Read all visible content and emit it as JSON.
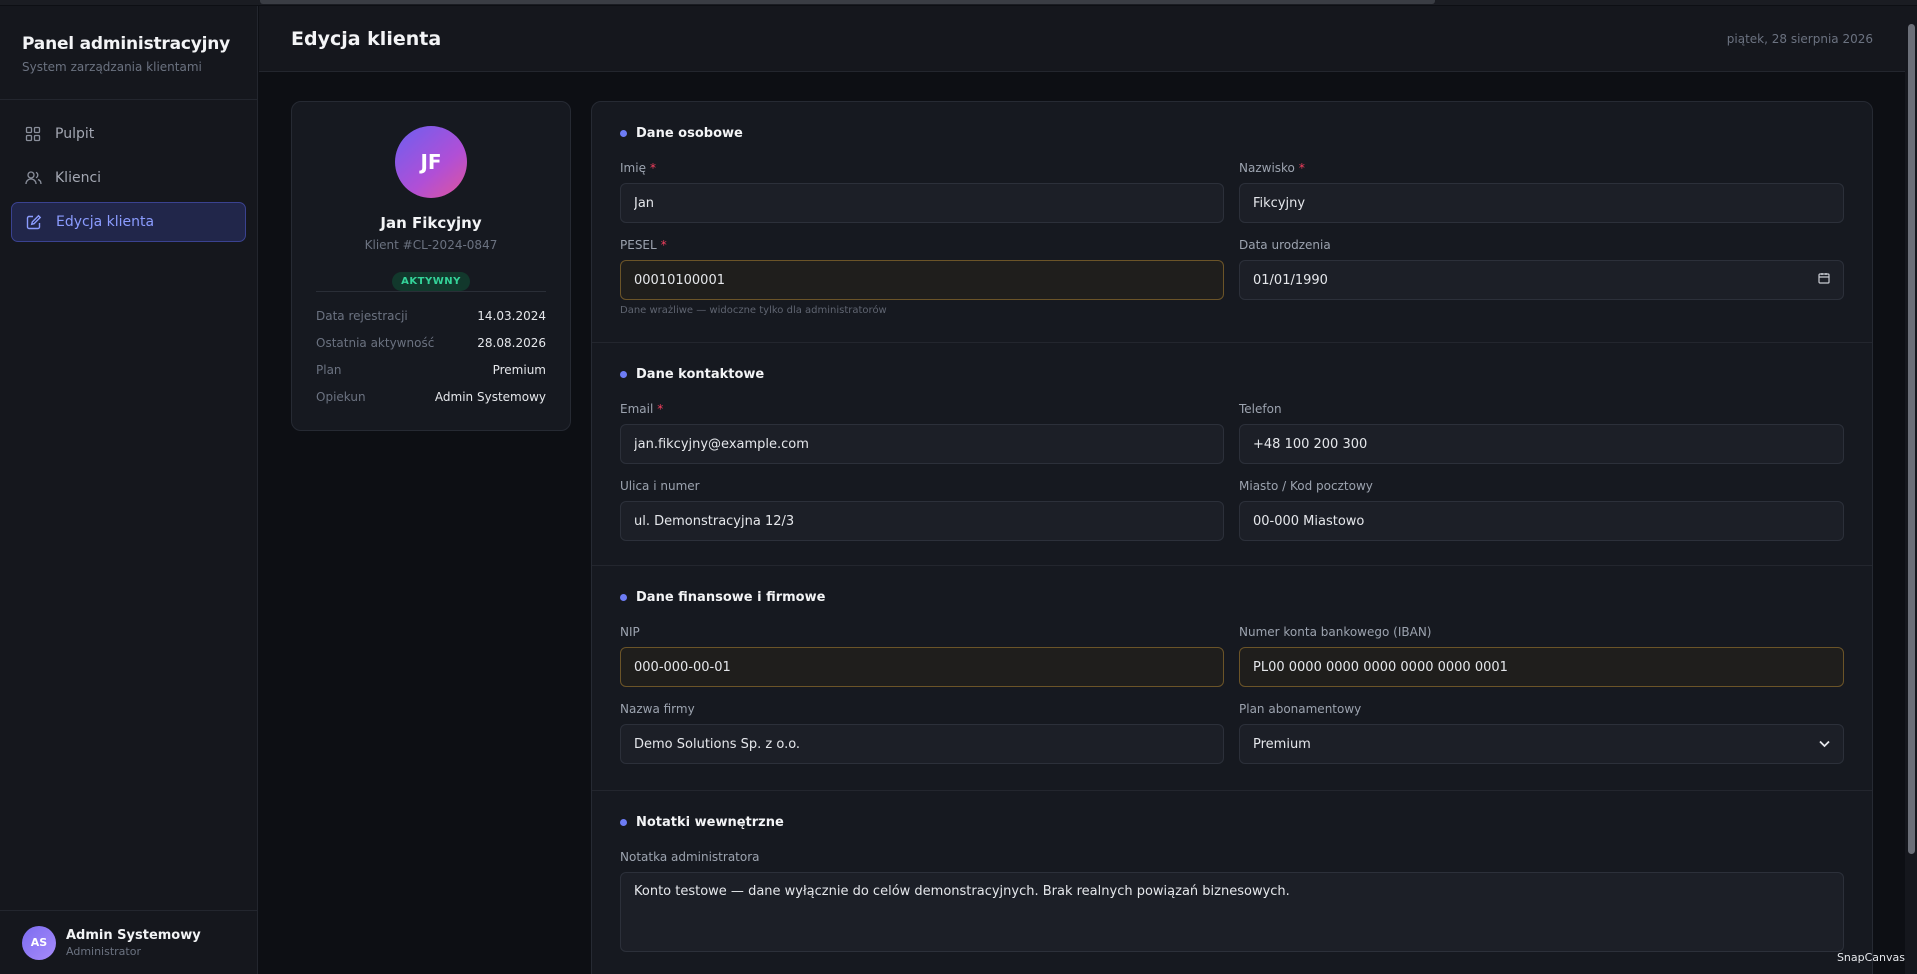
{
  "brand": {
    "title": "Panel administracyjny",
    "subtitle": "System zarządzania klientami"
  },
  "nav": [
    {
      "label": "Pulpit",
      "icon": "grid-icon"
    },
    {
      "label": "Klienci",
      "icon": "users-icon"
    },
    {
      "label": "Edycja klienta",
      "icon": "edit-icon",
      "active": true
    }
  ],
  "user": {
    "initials": "AS",
    "name": "Admin Systemowy",
    "role": "Administrator"
  },
  "header": {
    "title": "Edycja klienta",
    "date": "piątek, 28 sierpnia 2026"
  },
  "profile": {
    "initials": "JF",
    "name": "Jan Fikcyjny",
    "client_id": "Klient #CL-2024-0847",
    "status": "AKTYWNY",
    "rows": [
      {
        "key": "Data rejestracji",
        "value": "14.03.2024"
      },
      {
        "key": "Ostatnia aktywność",
        "value": "28.08.2026"
      },
      {
        "key": "Plan",
        "value": "Premium"
      },
      {
        "key": "Opiekun",
        "value": "Admin Systemowy"
      }
    ]
  },
  "sections": {
    "personal": {
      "title": "Dane osobowe",
      "first_name": {
        "label": "Imię",
        "value": "Jan"
      },
      "last_name": {
        "label": "Nazwisko",
        "value": "Fikcyjny"
      },
      "pesel": {
        "label": "PESEL",
        "value": "00010100001",
        "hint": "Dane wrażliwe — widoczne tylko dla administratorów"
      },
      "birth_date": {
        "label": "Data urodzenia",
        "value": "01/01/1990"
      }
    },
    "contact": {
      "title": "Dane kontaktowe",
      "email": {
        "label": "Email",
        "value": "jan.fikcyjny@example.com"
      },
      "phone": {
        "label": "Telefon",
        "value": "+48 100 200 300"
      },
      "street": {
        "label": "Ulica i numer",
        "value": "ul. Demonstracyjna 12/3"
      },
      "city": {
        "label": "Miasto / Kod pocztowy",
        "value": "00-000 Miastowo"
      }
    },
    "finance": {
      "title": "Dane finansowe i firmowe",
      "nip": {
        "label": "NIP",
        "value": "000-000-00-01"
      },
      "iban": {
        "label": "Numer konta bankowego (IBAN)",
        "value": "PL00 0000 0000 0000 0000 0000 0001"
      },
      "company": {
        "label": "Nazwa firmy",
        "value": "Demo Solutions Sp. z o.o."
      },
      "plan": {
        "label": "Plan abonamentowy",
        "value": "Premium"
      }
    },
    "notes": {
      "title": "Notatki wewnętrzne",
      "note": {
        "label": "Notatka administratora",
        "value": "Konto testowe — dane wyłącznie do celów demonstracyjnych. Brak realnych powiązań biznesowych."
      }
    }
  },
  "watermark": "SnapCanvas",
  "colors": {
    "accent": "#8b9cff",
    "required": "#f43f5e",
    "active_badge": "#34d399",
    "warn_border": "#6b5428"
  }
}
